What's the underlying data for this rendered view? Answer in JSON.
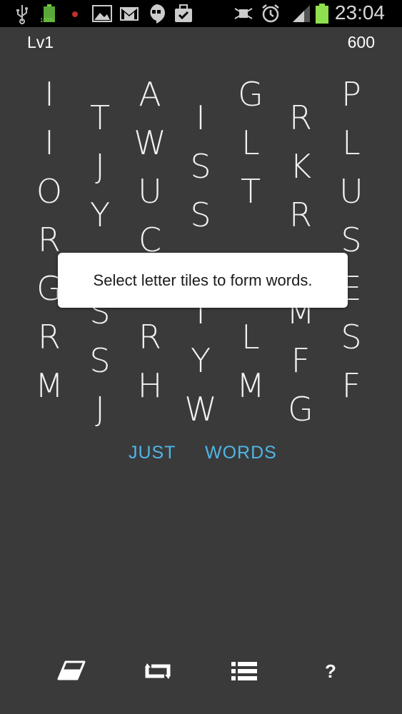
{
  "status_bar": {
    "battery_small_label": "100%",
    "time": "23:04"
  },
  "header": {
    "level": "Lv1",
    "score": "600"
  },
  "grid": {
    "columns": [
      [
        "I",
        "I",
        "O",
        "R",
        "G",
        "R",
        "M"
      ],
      [
        "T",
        "J",
        "Y",
        "",
        "S",
        "S",
        "J"
      ],
      [
        "A",
        "W",
        "U",
        "C",
        "",
        "R",
        "H"
      ],
      [
        "I",
        "S",
        "S",
        "",
        "I",
        "Y",
        "W"
      ],
      [
        "G",
        "L",
        "T",
        "",
        "",
        "L",
        "M"
      ],
      [
        "R",
        "K",
        "R",
        "",
        "M",
        "F",
        "G"
      ],
      [
        "P",
        "L",
        "U",
        "S",
        "E",
        "S",
        "F"
      ]
    ]
  },
  "toast": {
    "message": "Select letter tiles to form words."
  },
  "found_words": [
    "JUST",
    "WORDS"
  ],
  "toolbar": {
    "eraser_icon": "eraser-icon",
    "shuffle_icon": "shuffle-icon",
    "list_icon": "list-icon",
    "help_label": "?"
  },
  "colors": {
    "background": "#3a3a3b",
    "word_accent": "#4fb6e6",
    "tile_text": "#f2f2f2",
    "toast_bg": "#ffffff"
  }
}
